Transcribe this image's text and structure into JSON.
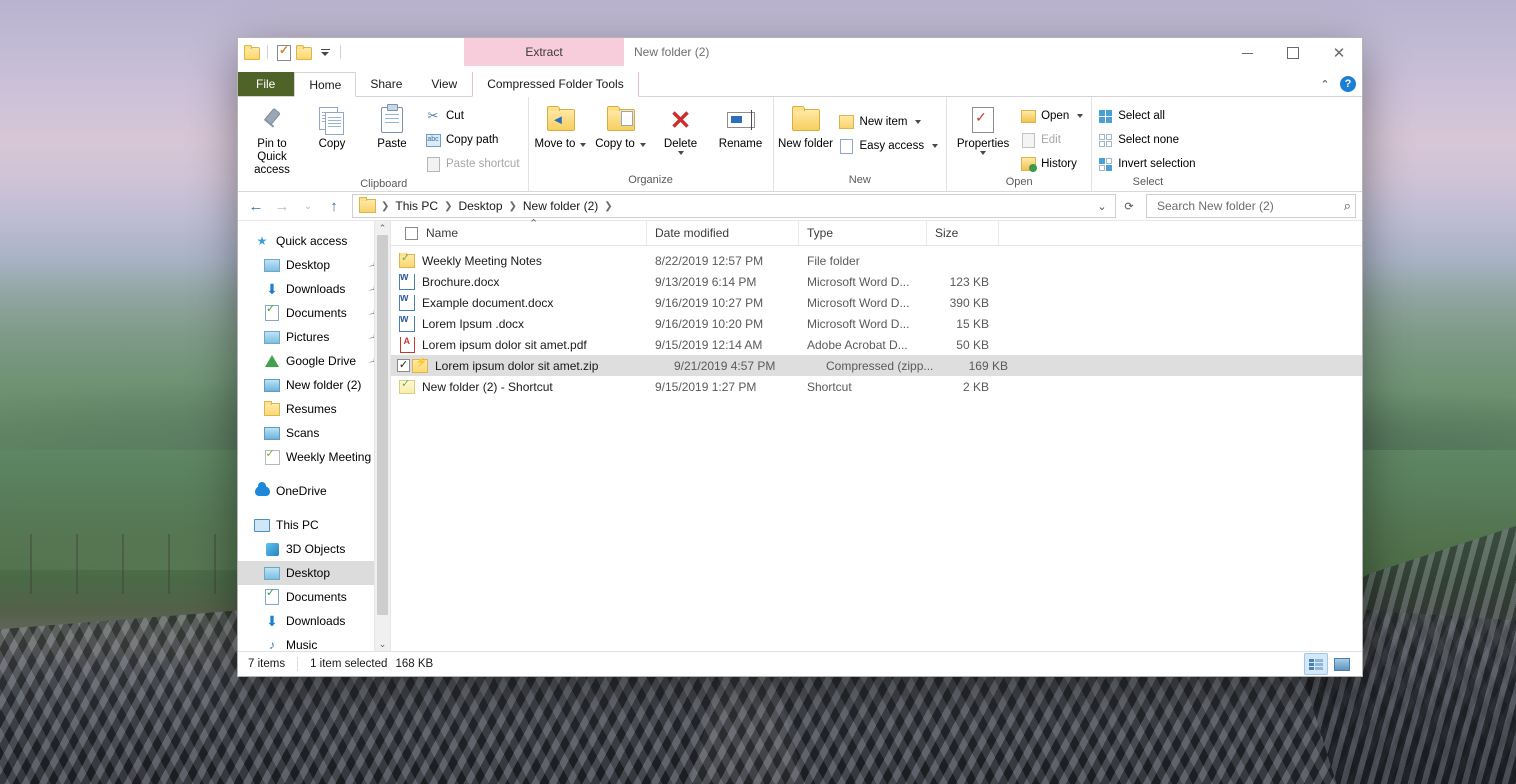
{
  "window": {
    "title": "New folder (2)",
    "contextual_tab_header": "Extract",
    "controls": {
      "minimize": "minimize",
      "maximize": "maximize",
      "close": "close"
    },
    "ribbon_collapse": "collapse-ribbon",
    "help": "?"
  },
  "quick_access_toolbar": {
    "items": [
      {
        "name": "properties-folder-icon",
        "icon": "folder-icon"
      },
      {
        "name": "new-folder-icon",
        "icon": "checked-document-icon"
      },
      {
        "name": "undo-folder-icon",
        "icon": "folder-icon"
      },
      {
        "name": "customize-qat",
        "icon": "chevron-down-icon"
      }
    ]
  },
  "tabs": [
    {
      "label": "File",
      "kind": "file"
    },
    {
      "label": "Home",
      "kind": "active"
    },
    {
      "label": "Share",
      "kind": "normal"
    },
    {
      "label": "View",
      "kind": "normal"
    },
    {
      "label": "Compressed Folder Tools",
      "kind": "contextual"
    }
  ],
  "ribbon": {
    "groups": [
      {
        "name": "Clipboard",
        "big_buttons": [
          {
            "label": "Pin to Quick access",
            "icon": "pin-icon",
            "disabled": false
          },
          {
            "label": "Copy",
            "icon": "copy-icon",
            "disabled": false
          },
          {
            "label": "Paste",
            "icon": "paste-icon",
            "disabled": false
          }
        ],
        "small_buttons": [
          {
            "label": "Cut",
            "icon": "scissors-icon",
            "disabled": false
          },
          {
            "label": "Copy path",
            "icon": "copy-path-icon",
            "disabled": false
          },
          {
            "label": "Paste shortcut",
            "icon": "paste-shortcut-icon",
            "disabled": true
          }
        ]
      },
      {
        "name": "Organize",
        "big_buttons": [
          {
            "label": "Move to",
            "icon": "move-to-icon",
            "dropdown": true
          },
          {
            "label": "Copy to",
            "icon": "copy-to-icon",
            "dropdown": true
          },
          {
            "label": "Delete",
            "icon": "delete-x-icon",
            "dropdown": true
          },
          {
            "label": "Rename",
            "icon": "rename-icon",
            "dropdown": false
          }
        ],
        "small_buttons": []
      },
      {
        "name": "New",
        "big_buttons": [
          {
            "label": "New folder",
            "icon": "new-folder-icon",
            "dropdown": false
          }
        ],
        "small_buttons": [
          {
            "label": "New item",
            "icon": "new-item-icon",
            "dropdown": true
          },
          {
            "label": "Easy access",
            "icon": "easy-access-icon",
            "dropdown": true
          }
        ]
      },
      {
        "name": "Open",
        "big_buttons": [
          {
            "label": "Properties",
            "icon": "properties-icon",
            "dropdown": true
          }
        ],
        "small_buttons": [
          {
            "label": "Open",
            "icon": "open-icon",
            "dropdown": true
          },
          {
            "label": "Edit",
            "icon": "edit-icon",
            "disabled": true
          },
          {
            "label": "History",
            "icon": "history-icon",
            "disabled": false
          }
        ]
      },
      {
        "name": "Select",
        "big_buttons": [],
        "small_buttons": [
          {
            "label": "Select all",
            "icon": "select-all-icon"
          },
          {
            "label": "Select none",
            "icon": "select-none-icon"
          },
          {
            "label": "Invert selection",
            "icon": "invert-selection-icon"
          }
        ]
      }
    ]
  },
  "address_bar": {
    "back": "back-arrow",
    "forward": "forward-arrow",
    "recent": "recent-locations-chevron",
    "up": "up-arrow",
    "breadcrumbs": [
      "This PC",
      "Desktop",
      "New folder (2)"
    ],
    "dropdown": "address-dropdown",
    "refresh": "refresh-icon",
    "search_placeholder": "Search New folder (2)",
    "search_value": ""
  },
  "nav_pane": {
    "items": [
      {
        "label": "Quick access",
        "icon": "quick-access-star-icon",
        "indent": 0,
        "pinned": false,
        "selected": false
      },
      {
        "label": "Desktop",
        "icon": "desktop-icon",
        "indent": 1,
        "pinned": true,
        "selected": false
      },
      {
        "label": "Downloads",
        "icon": "downloads-icon",
        "indent": 1,
        "pinned": true,
        "selected": false
      },
      {
        "label": "Documents",
        "icon": "documents-icon",
        "indent": 1,
        "pinned": true,
        "selected": false
      },
      {
        "label": "Pictures",
        "icon": "pictures-icon",
        "indent": 1,
        "pinned": true,
        "selected": false
      },
      {
        "label": "Google Drive",
        "icon": "google-drive-icon",
        "indent": 1,
        "pinned": true,
        "selected": false
      },
      {
        "label": "New folder (2)",
        "icon": "scan-folder-icon",
        "indent": 1,
        "pinned": false,
        "selected": false
      },
      {
        "label": "Resumes",
        "icon": "folder-icon",
        "indent": 1,
        "pinned": false,
        "selected": false
      },
      {
        "label": "Scans",
        "icon": "scan-folder-icon",
        "indent": 1,
        "pinned": false,
        "selected": false
      },
      {
        "label": "Weekly Meeting",
        "icon": "shortcut-folder-icon",
        "indent": 1,
        "pinned": false,
        "selected": false
      },
      {
        "label": "OneDrive",
        "icon": "onedrive-cloud-icon",
        "indent": 0,
        "pinned": false,
        "selected": false,
        "spacer_before": true
      },
      {
        "label": "This PC",
        "icon": "this-pc-monitor-icon",
        "indent": 0,
        "pinned": false,
        "selected": false,
        "spacer_before": true
      },
      {
        "label": "3D Objects",
        "icon": "3d-objects-icon",
        "indent": 1,
        "pinned": false,
        "selected": false
      },
      {
        "label": "Desktop",
        "icon": "desktop-icon",
        "indent": 1,
        "pinned": false,
        "selected": true
      },
      {
        "label": "Documents",
        "icon": "documents-icon",
        "indent": 1,
        "pinned": false,
        "selected": false
      },
      {
        "label": "Downloads",
        "icon": "downloads-icon",
        "indent": 1,
        "pinned": false,
        "selected": false
      },
      {
        "label": "Music",
        "icon": "music-icon",
        "indent": 1,
        "pinned": false,
        "selected": false
      }
    ]
  },
  "file_list": {
    "columns": [
      "Name",
      "Date modified",
      "Type",
      "Size"
    ],
    "sort_column": "Name",
    "sort_direction": "ascending",
    "header_checkbox_checked": false,
    "rows": [
      {
        "name": "Weekly Meeting Notes",
        "date": "8/22/2019 12:57 PM",
        "type": "File folder",
        "size": "",
        "icon": "folder-check-icon",
        "selected": false
      },
      {
        "name": "Brochure.docx",
        "date": "9/13/2019 6:14 PM",
        "type": "Microsoft Word D...",
        "size": "123 KB",
        "icon": "word-doc-icon",
        "selected": false
      },
      {
        "name": "Example document.docx",
        "date": "9/16/2019 10:27 PM",
        "type": "Microsoft Word D...",
        "size": "390 KB",
        "icon": "word-doc-icon",
        "selected": false
      },
      {
        "name": "Lorem Ipsum .docx",
        "date": "9/16/2019 10:20 PM",
        "type": "Microsoft Word D...",
        "size": "15 KB",
        "icon": "word-doc-icon",
        "selected": false
      },
      {
        "name": "Lorem ipsum dolor sit amet.pdf",
        "date": "9/15/2019 12:14 AM",
        "type": "Adobe Acrobat D...",
        "size": "50 KB",
        "icon": "pdf-icon",
        "selected": false
      },
      {
        "name": "Lorem ipsum dolor sit amet.zip",
        "date": "9/21/2019 4:57 PM",
        "type": "Compressed (zipp...",
        "size": "169 KB",
        "icon": "zip-icon",
        "selected": true
      },
      {
        "name": "New folder (2) - Shortcut",
        "date": "9/15/2019 1:27 PM",
        "type": "Shortcut",
        "size": "2 KB",
        "icon": "shortcut-icon",
        "selected": false
      }
    ]
  },
  "status_bar": {
    "item_count": "7 items",
    "selection": "1 item selected",
    "selection_size": "168 KB",
    "view_details": "details-view-icon",
    "view_large_icons": "large-icons-view-icon",
    "active_view": "details"
  },
  "colors": {
    "file_tab": "#4f6228",
    "contextual_tab": "#f8cddb",
    "selection": "#dedede",
    "accent": "#1b7fd4"
  }
}
